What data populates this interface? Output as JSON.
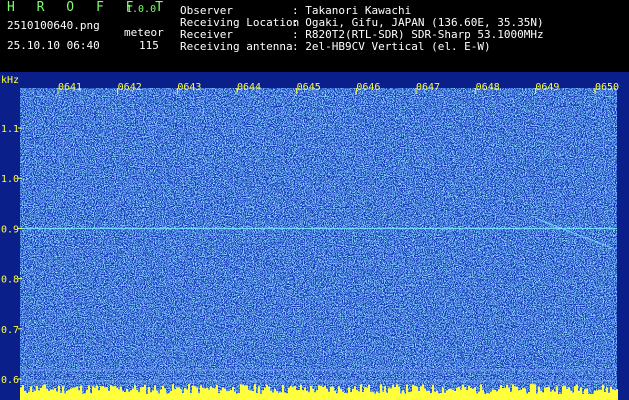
{
  "header": {
    "app_title": "H R O F F T",
    "version": "1.0.0",
    "filename": "2510100640.png",
    "datetime": "25.10.10 06:40",
    "meteor_label": "meteor",
    "meteor_count": "115",
    "info_labels": [
      "Observer",
      "Receiving Location",
      "Receiver",
      "Receiving antenna"
    ],
    "info_values": [
      ": Takanori Kawachi",
      ": Ogaki, Gifu, JAPAN (136.60E, 35.35N)",
      ": R820T2(RTL-SDR) SDR-Sharp 53.1000MHz",
      ": 2el-HB9CV Vertical (el. E-W)"
    ]
  },
  "spectrogram": {
    "y_unit": "kHz",
    "y_ticks": [
      "1.1",
      "1.0",
      "0.9",
      "0.8",
      "0.7",
      "0.6"
    ],
    "time_labels": [
      "0641",
      "0642",
      "0643",
      "0644",
      "0645",
      "0646",
      "0647",
      "0648",
      "0649",
      "0650"
    ],
    "carrier_khz": 0.9,
    "colors": {
      "background": "#1536b8",
      "noise": "#2e8cff",
      "signal": "#7cf2ff",
      "labels": "#ffff3c"
    }
  }
}
